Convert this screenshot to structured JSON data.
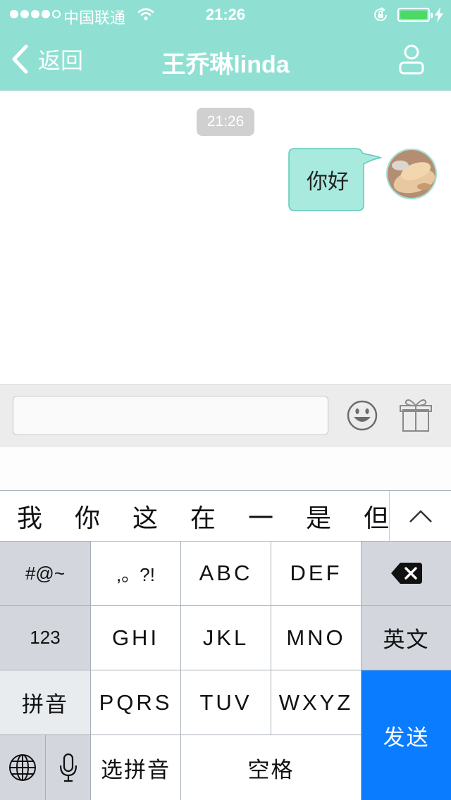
{
  "status_bar": {
    "carrier": "中国联通",
    "time": "21:26",
    "signal_filled": 4,
    "signal_total": 5,
    "battery_color": "#4cd964"
  },
  "nav": {
    "back_label": "返回",
    "title": "王乔琳linda",
    "bar_color": "#8fe0d3"
  },
  "chat": {
    "timestamp": "21:26",
    "messages": [
      {
        "sender": "me",
        "text": "你好",
        "bubble_color": "#a9eadf"
      }
    ]
  },
  "input": {
    "value": "",
    "placeholder": ""
  },
  "candidates": {
    "items": [
      "我",
      "你",
      "这",
      "在",
      "一",
      "是",
      "但"
    ]
  },
  "keyboard": {
    "row1": {
      "symbols": "#@~",
      "punct": ",。?!",
      "abc": "ABC",
      "def": "DEF"
    },
    "row2": {
      "num": "123",
      "ghi": "GHI",
      "jkl": "JKL",
      "mno": "MNO",
      "english": "英文"
    },
    "row3": {
      "pinyin": "拼音",
      "pqrs": "PQRS",
      "tuv": "TUV",
      "wxyz": "WXYZ"
    },
    "row4": {
      "select_pinyin": "选拼音",
      "space": "空格"
    },
    "send": "发送",
    "send_color": "#0a7cff"
  }
}
